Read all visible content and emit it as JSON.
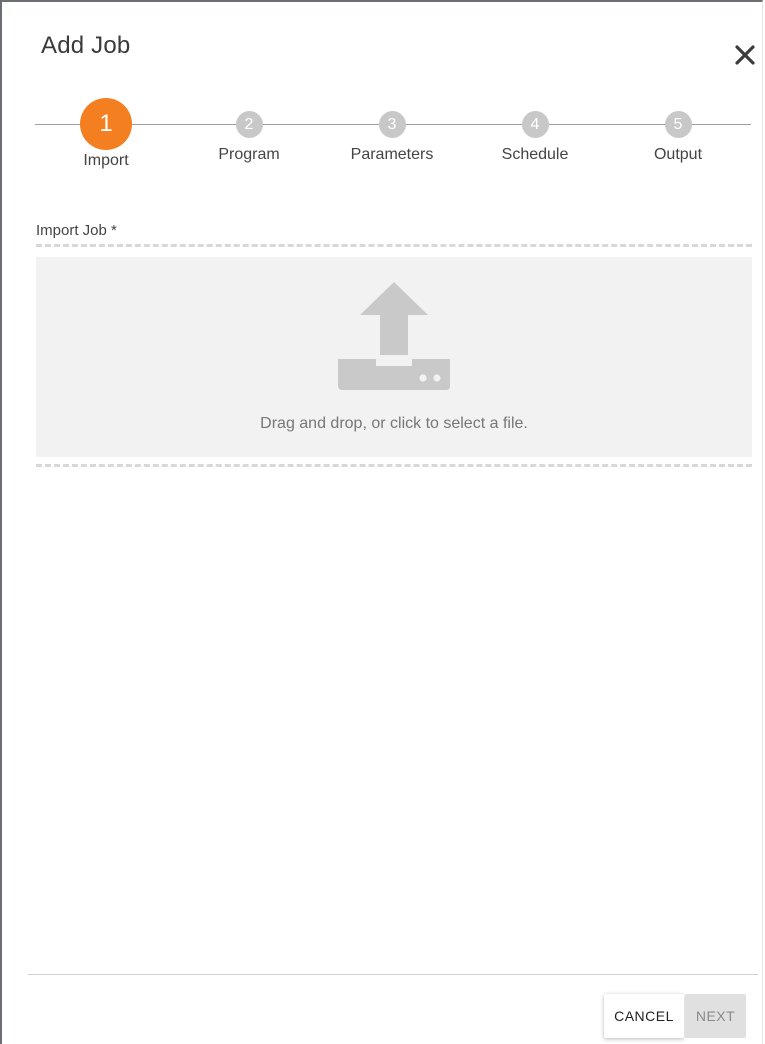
{
  "dialog": {
    "title": "Add Job",
    "close_icon": "close-icon"
  },
  "stepper": {
    "active_index": 0,
    "accent_color": "#f47f20",
    "inactive_color": "#c8c8c8",
    "steps": [
      {
        "number": "1",
        "label": "Import"
      },
      {
        "number": "2",
        "label": "Program"
      },
      {
        "number": "3",
        "label": "Parameters"
      },
      {
        "number": "4",
        "label": "Schedule"
      },
      {
        "number": "5",
        "label": "Output"
      }
    ]
  },
  "import_field": {
    "label": "Import Job *",
    "icon": "upload-icon",
    "dropzone_text": "Drag and drop, or click to select a file."
  },
  "footer": {
    "cancel_label": "CANCEL",
    "next_label": "NEXT"
  }
}
